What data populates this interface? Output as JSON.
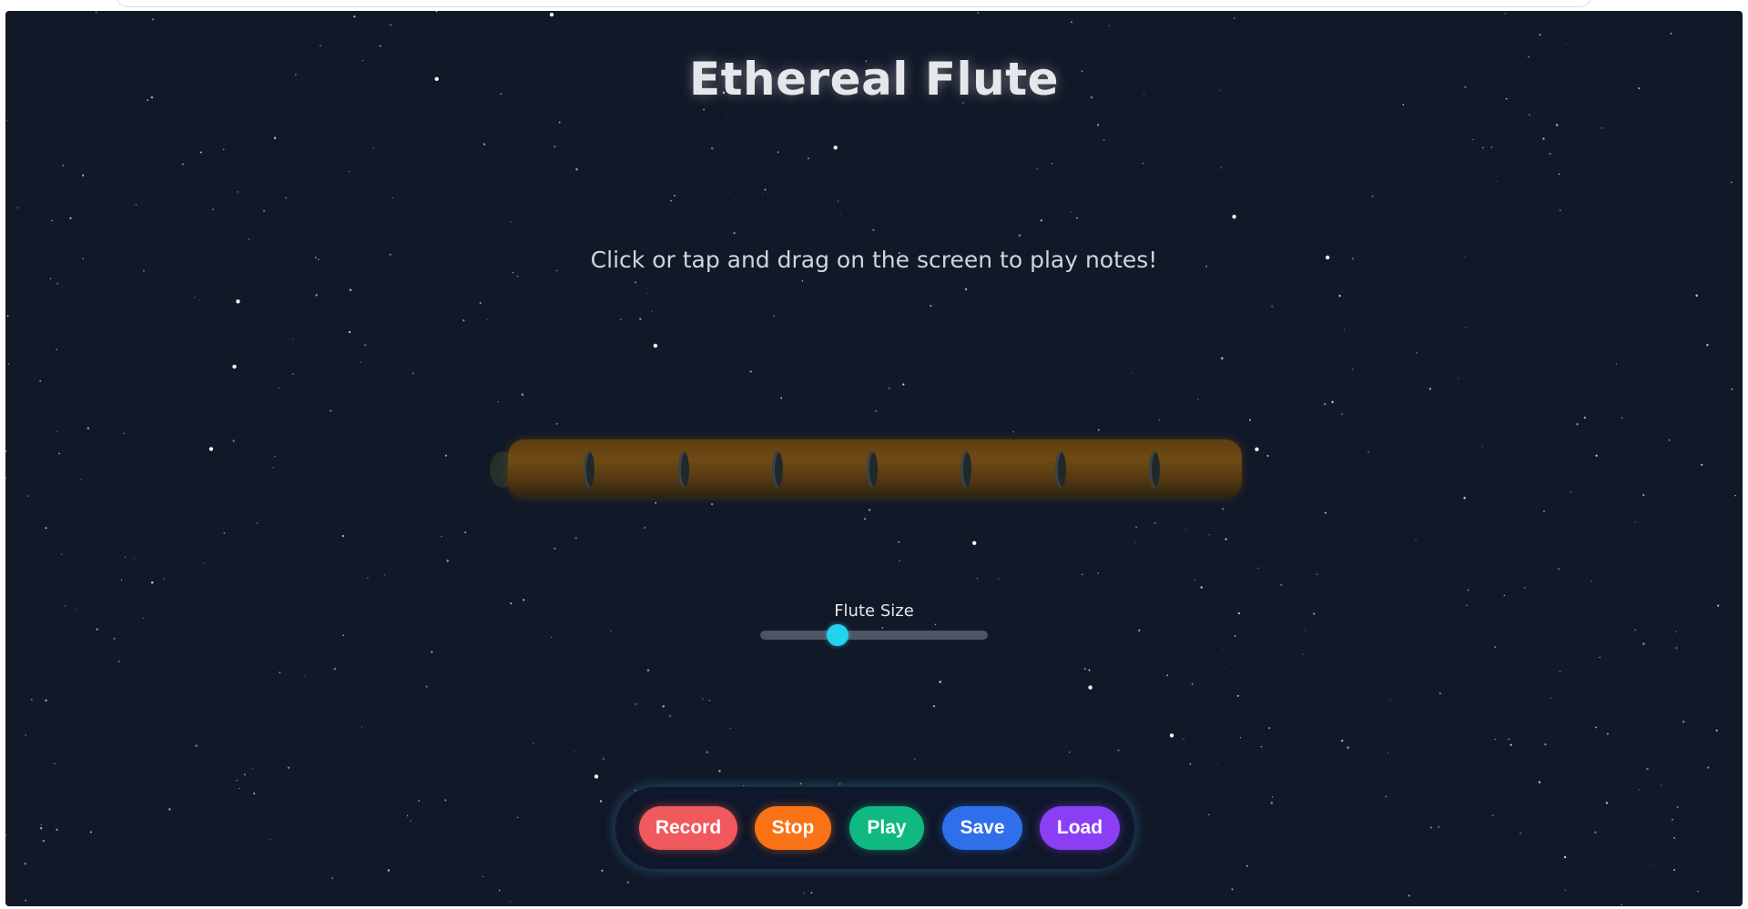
{
  "app": {
    "title": "Ethereal Flute",
    "instructions": "Click or tap and drag on the screen to play notes!"
  },
  "slider": {
    "label": "Flute Size",
    "value_fraction": 0.34
  },
  "controls": [
    {
      "name": "record-button",
      "label": "Record",
      "color": "#f0595e"
    },
    {
      "name": "stop-button",
      "label": "Stop",
      "color": "#f97316"
    },
    {
      "name": "play-button",
      "label": "Play",
      "color": "#10b981"
    },
    {
      "name": "save-button",
      "label": "Save",
      "color": "#2f6fea"
    },
    {
      "name": "load-button",
      "label": "Load",
      "color": "#8b3ff5"
    }
  ],
  "colors": {
    "background": "#111827",
    "accent": "#22d3ee",
    "flute_wood": "#6e4a15"
  },
  "flute": {
    "hole_count": 7
  }
}
